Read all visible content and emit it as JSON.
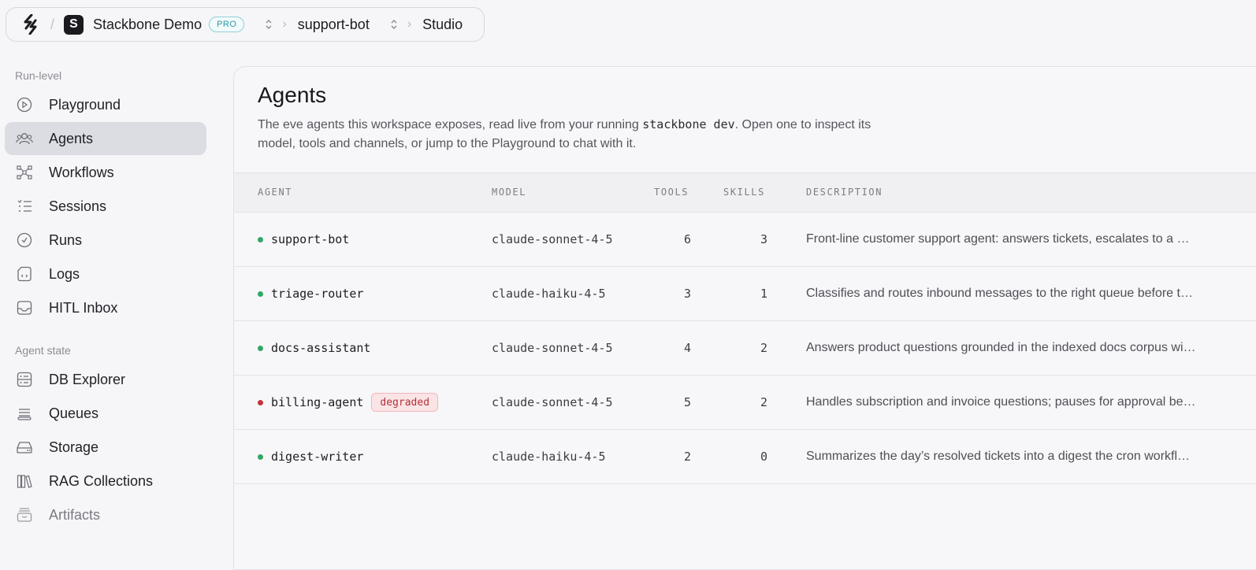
{
  "breadcrumb": {
    "workspace_initial": "S",
    "workspace_name": "Stackbone Demo",
    "plan_badge": "PRO",
    "project": "support-bot",
    "page": "Studio"
  },
  "sidebar": {
    "sections": [
      {
        "label": "Run-level",
        "items": [
          {
            "label": "Playground",
            "icon": "play-circle-icon"
          },
          {
            "label": "Agents",
            "icon": "users-icon",
            "active": true
          },
          {
            "label": "Workflows",
            "icon": "workflow-icon"
          },
          {
            "label": "Sessions",
            "icon": "list-icon"
          },
          {
            "label": "Runs",
            "icon": "clock-icon"
          },
          {
            "label": "Logs",
            "icon": "log-file-icon"
          },
          {
            "label": "HITL Inbox",
            "icon": "inbox-icon"
          }
        ]
      },
      {
        "label": "Agent state",
        "items": [
          {
            "label": "DB Explorer",
            "icon": "database-icon"
          },
          {
            "label": "Queues",
            "icon": "queue-icon"
          },
          {
            "label": "Storage",
            "icon": "storage-icon"
          },
          {
            "label": "RAG Collections",
            "icon": "books-icon"
          },
          {
            "label": "Artifacts",
            "icon": "archive-icon"
          }
        ]
      }
    ]
  },
  "main": {
    "title": "Agents",
    "desc_before": "The eve agents this workspace exposes, read live from your running ",
    "desc_code": "stackbone dev",
    "desc_after": ". Open one to inspect its model, tools and channels, or jump to the Playground to chat with it."
  },
  "table": {
    "columns": [
      "AGENT",
      "MODEL",
      "TOOLS",
      "SKILLS",
      "DESCRIPTION"
    ],
    "rows": [
      {
        "name": "support-bot",
        "status_color": "#2fa866",
        "badge": "",
        "model": "claude-sonnet-4-5",
        "tools": "6",
        "skills": "3",
        "description": "Front-line customer support agent: answers tickets, escalates to a …"
      },
      {
        "name": "triage-router",
        "status_color": "#2fa866",
        "badge": "",
        "model": "claude-haiku-4-5",
        "tools": "3",
        "skills": "1",
        "description": "Classifies and routes inbound messages to the right queue before t…"
      },
      {
        "name": "docs-assistant",
        "status_color": "#2fa866",
        "badge": "",
        "model": "claude-sonnet-4-5",
        "tools": "4",
        "skills": "2",
        "description": "Answers product questions grounded in the indexed docs corpus wi…"
      },
      {
        "name": "billing-agent",
        "status_color": "#c5333f",
        "badge": "degraded",
        "model": "claude-sonnet-4-5",
        "tools": "5",
        "skills": "2",
        "description": "Handles subscription and invoice questions; pauses for approval be…"
      },
      {
        "name": "digest-writer",
        "status_color": "#2fa866",
        "badge": "",
        "model": "claude-haiku-4-5",
        "tools": "2",
        "skills": "0",
        "description": "Summarizes the day’s resolved tickets into a digest the cron workfl…"
      }
    ]
  }
}
